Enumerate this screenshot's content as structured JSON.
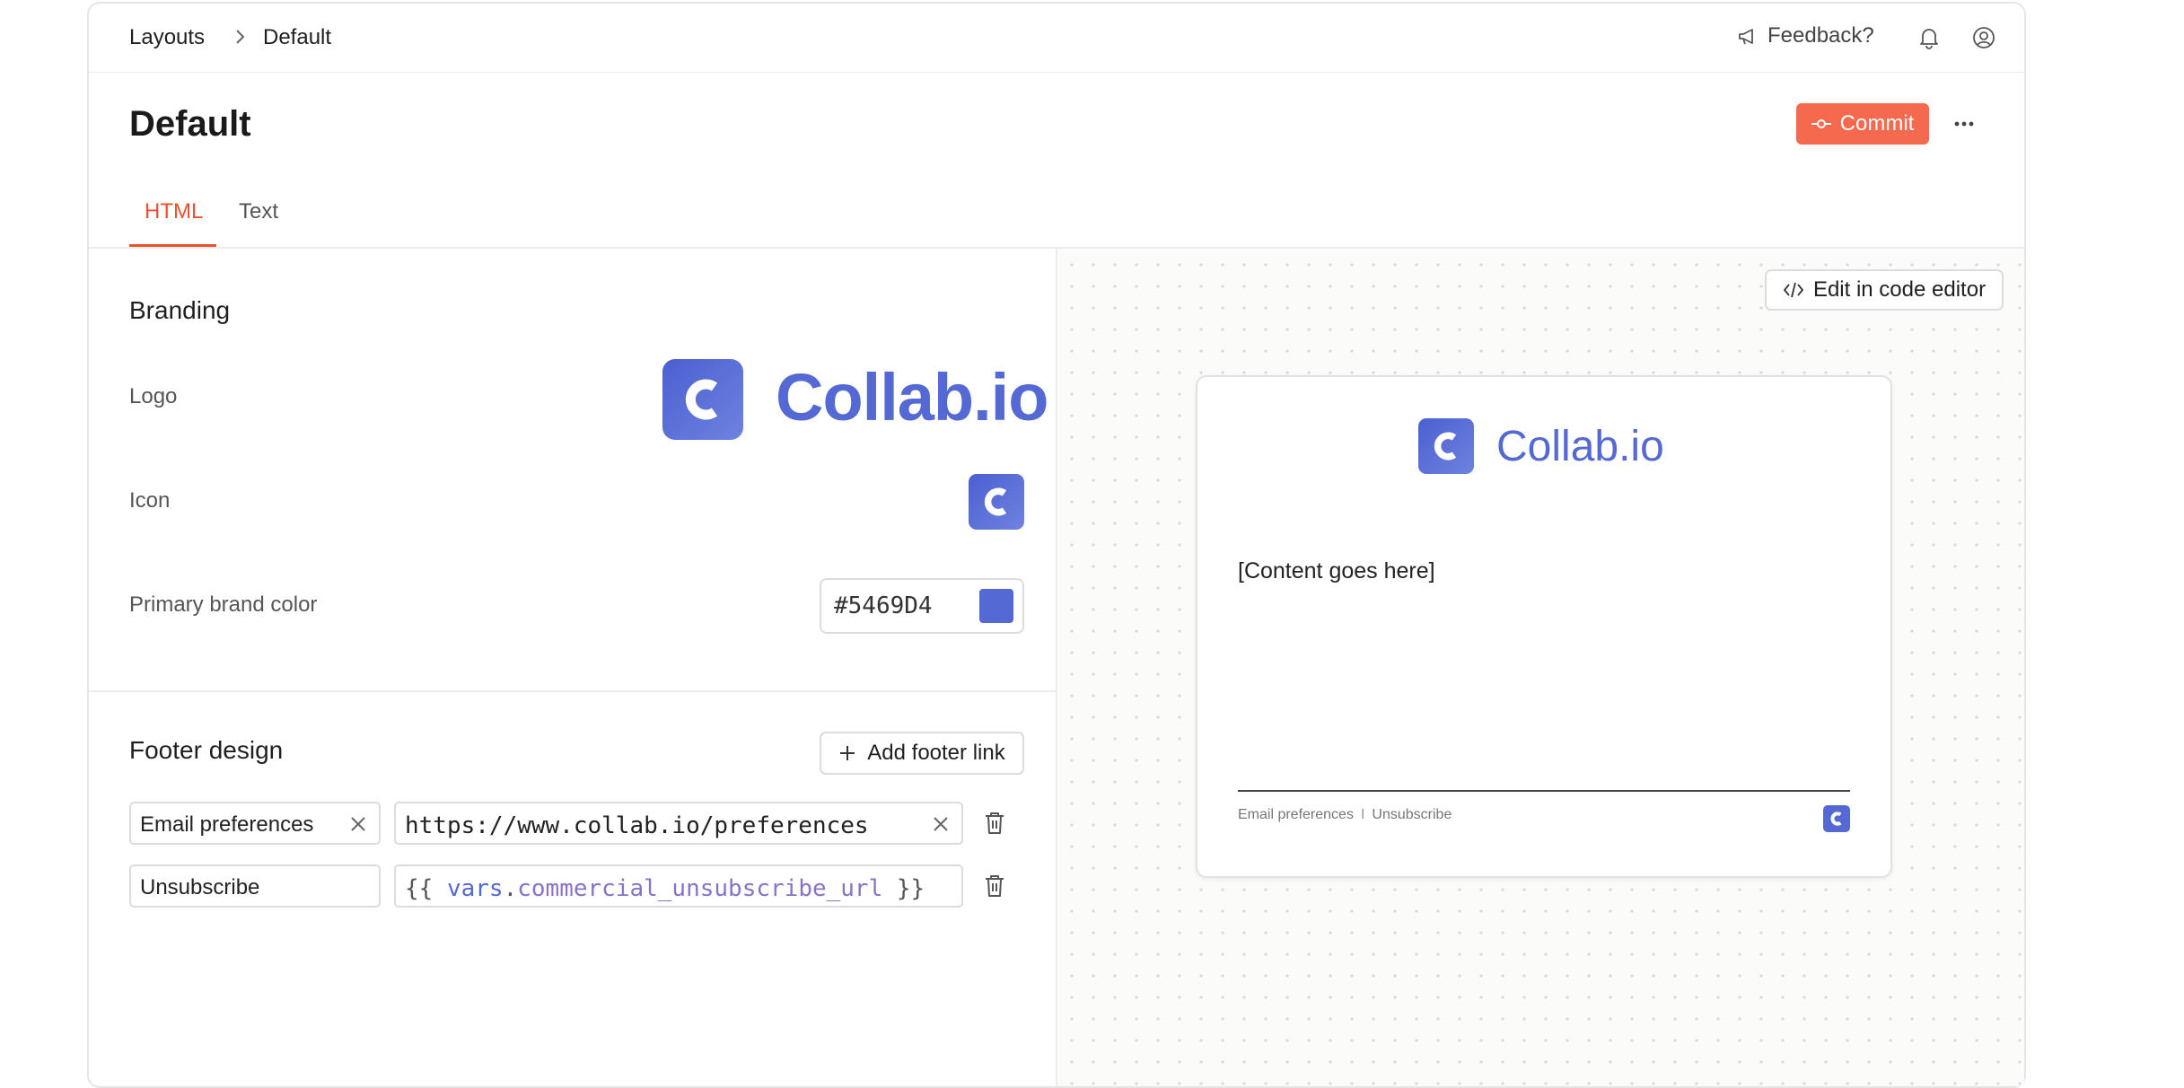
{
  "breadcrumb": {
    "root": "Layouts",
    "current": "Default"
  },
  "topbar": {
    "feedback_label": "Feedback?",
    "icons": [
      "megaphone-icon",
      "bell-icon",
      "user-circle-icon"
    ]
  },
  "header": {
    "title": "Default",
    "commit_label": "Commit",
    "more_icon": "ellipsis-icon"
  },
  "tabs": [
    {
      "label": "HTML",
      "active": true
    },
    {
      "label": "Text",
      "active": false
    }
  ],
  "branding": {
    "section_title": "Branding",
    "logo_label": "Logo",
    "logo_wordmark": "Collab.io",
    "logo_letter": "C",
    "icon_label": "Icon",
    "primary_color_label": "Primary brand color",
    "primary_color_value": "#5469D4",
    "primary_color": "#5469d4"
  },
  "footer_design": {
    "section_title": "Footer design",
    "add_link_label": "Add footer link",
    "links": [
      {
        "label": "Email preferences",
        "url": "https://www.collab.io/preferences"
      },
      {
        "label": "Unsubscribe",
        "url_template": {
          "open": "{{",
          "var_obj": "vars",
          "dot": ".",
          "var_name": "commercial_unsubscribe_url",
          "close": "}}"
        }
      }
    ]
  },
  "preview": {
    "edit_button_label": "Edit in code editor",
    "wordmark": "Collab.io",
    "logo_letter": "C",
    "content_placeholder": "[Content goes here]",
    "footer_links": [
      "Email preferences",
      "Unsubscribe"
    ],
    "footer_separator": "I"
  },
  "colors": {
    "accent": "#f56a4e",
    "active_tab": "#e9512f",
    "brand": "#5469d4"
  }
}
